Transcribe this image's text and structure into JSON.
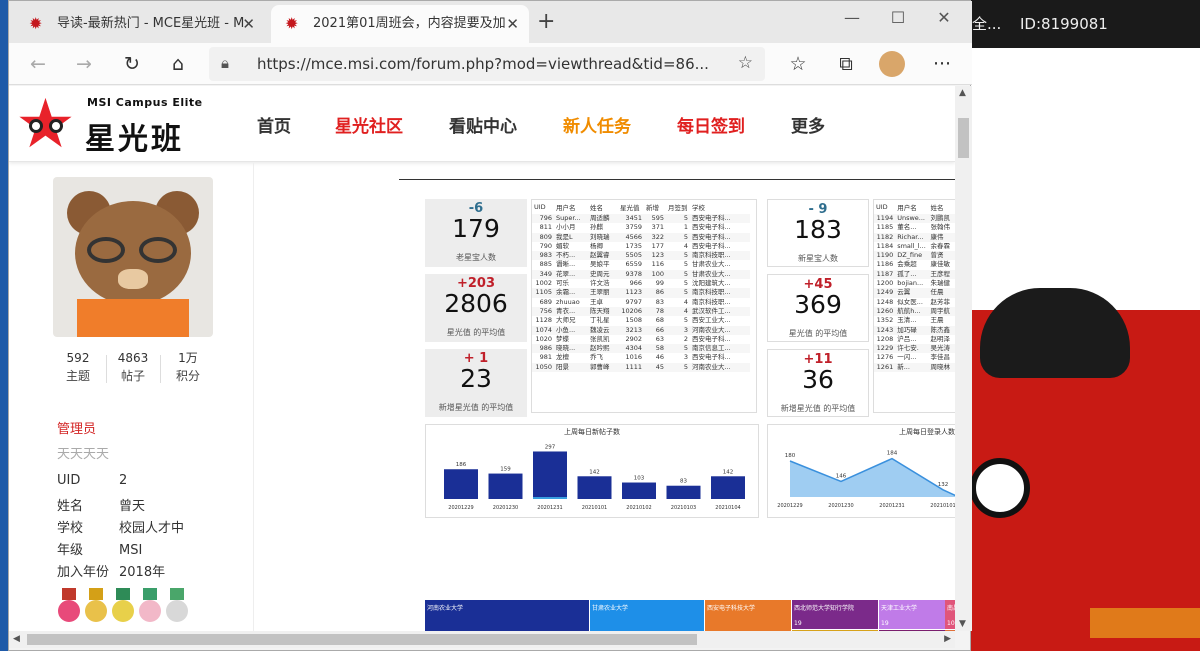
{
  "window": {
    "tabs": [
      {
        "label": "导读-最新热门 - MCE星光班 - M"
      },
      {
        "label": "2021第01周班会，内容提要及加"
      }
    ],
    "new_tab": "+",
    "min": "—",
    "max": "☐",
    "close": "✕"
  },
  "toolbar": {
    "back": "←",
    "forward": "→",
    "refresh": "↻",
    "home": "⌂",
    "url": "https://mce.msi.com/forum.php?mod=viewthread&tid=86...",
    "fav": "☆",
    "favbar": "☆",
    "collections": "⧉",
    "more": "···"
  },
  "right_panel": {
    "text1": "全...",
    "text2": "ID:8199081"
  },
  "site": {
    "logo_en": "MSI Campus Elite",
    "logo_cn": "星光班",
    "nav": [
      {
        "label": "首页",
        "color": "#333333"
      },
      {
        "label": "星光社区",
        "color": "#e02020"
      },
      {
        "label": "看贴中心",
        "color": "#333333"
      },
      {
        "label": "新人任务",
        "color": "#f08c00"
      },
      {
        "label": "每日签到",
        "color": "#e02020"
      },
      {
        "label": "更多",
        "color": "#333333"
      }
    ]
  },
  "profile": {
    "stats": [
      {
        "value": "592",
        "label": "主题"
      },
      {
        "value": "4863",
        "label": "帖子"
      },
      {
        "value": "1万",
        "label": "积分"
      }
    ],
    "role": "管理员",
    "role_sub": "天天天天",
    "info": [
      {
        "k": "UID",
        "v": "2"
      },
      {
        "k": "姓名",
        "v": "曾天"
      },
      {
        "k": "学校",
        "v": "校园人才中"
      },
      {
        "k": "年级",
        "v": "MSI"
      },
      {
        "k": "加入年份",
        "v": "2018年"
      }
    ]
  },
  "kpis_left": [
    {
      "delta": "-6",
      "delta_color": "#2f6e8e",
      "value": "179",
      "label": "老星宝人数"
    },
    {
      "delta": "+203",
      "delta_color": "#c0202a",
      "value": "2806",
      "label": "星光值 的平均值"
    },
    {
      "delta": "+ 1",
      "delta_color": "#c0202a",
      "value": "23",
      "label": "新增星光值 的平均值"
    }
  ],
  "kpis_right": [
    {
      "delta": "- 9",
      "delta_color": "#2f6e8e",
      "value": "183",
      "label": "新星宝人数"
    },
    {
      "delta": "+45",
      "delta_color": "#c0202a",
      "value": "369",
      "label": "星光值 的平均值"
    },
    {
      "delta": "+11",
      "delta_color": "#c0202a",
      "value": "36",
      "label": "新增星光值 的平均值"
    }
  ],
  "table1": {
    "headers": [
      "UID",
      "用户名",
      "姓名",
      "星光值",
      "新增",
      "月签到",
      "学校"
    ],
    "rows": [
      [
        "796",
        "Super...",
        "周适麟",
        "3451",
        "595",
        "5",
        "西安电子科..."
      ],
      [
        "811",
        "小小月",
        "孙麒",
        "3759",
        "371",
        "1",
        "西安电子科..."
      ],
      [
        "809",
        "我是L",
        "刘晓瑞",
        "4566",
        "322",
        "5",
        "西安电子科..."
      ],
      [
        "790",
        "媚软",
        "杨卿",
        "1735",
        "177",
        "4",
        "西安电子科..."
      ],
      [
        "983",
        "不朽...",
        "赵翼睿",
        "5505",
        "123",
        "5",
        "南京科技职..."
      ],
      [
        "885",
        "谮晰...",
        "吴娘平",
        "6559",
        "116",
        "5",
        "甘肃农业大..."
      ],
      [
        "349",
        "花翠...",
        "史周元",
        "9378",
        "100",
        "5",
        "甘肃农业大..."
      ],
      [
        "1002",
        "可乐",
        "许文浩",
        "966",
        "99",
        "5",
        "沈阳建筑大..."
      ],
      [
        "1105",
        "余霜...",
        "王翠丽",
        "1123",
        "86",
        "5",
        "南京科技职..."
      ],
      [
        "689",
        "zhuuao",
        "王卓",
        "9797",
        "83",
        "4",
        "南京科技职..."
      ],
      [
        "756",
        "青衣...",
        "陈天翔",
        "10206",
        "78",
        "4",
        "武汉软件工..."
      ],
      [
        "1128",
        "大师兄",
        "丁礼星",
        "1508",
        "68",
        "5",
        "西安工业大..."
      ],
      [
        "1074",
        "小鱼...",
        "魏凌云",
        "3213",
        "66",
        "3",
        "河南农业大..."
      ],
      [
        "1020",
        "梦蝶",
        "张凯凯",
        "2902",
        "63",
        "2",
        "西安电子科..."
      ],
      [
        "986",
        "晓晓...",
        "赵吟熙",
        "4304",
        "58",
        "5",
        "南京信息工..."
      ],
      [
        "981",
        "龙檀",
        "乔飞",
        "1016",
        "46",
        "3",
        "西安电子科..."
      ],
      [
        "1050",
        "阳景",
        "郭曹峰",
        "1111",
        "45",
        "5",
        "河南农业大..."
      ]
    ]
  },
  "table2": {
    "headers": [
      "UID",
      "用户名",
      "姓名"
    ],
    "rows": [
      [
        "1194",
        "Unswe...",
        "刘鹏凯"
      ],
      [
        "1185",
        "董名...",
        "张翰伟"
      ],
      [
        "1182",
        "Richar...",
        "康伟"
      ],
      [
        "1184",
        "small_l...",
        "余春霖"
      ],
      [
        "1190",
        "DZ_fine",
        "曾贤"
      ],
      [
        "1186",
        "会乘超",
        "康佳敏"
      ],
      [
        "1187",
        "孤了...",
        "王彦程"
      ],
      [
        "1200",
        "bojian...",
        "朱瑞健"
      ],
      [
        "1249",
        "云翼",
        "任晨"
      ],
      [
        "1248",
        "似女医...",
        "赵芳菲"
      ],
      [
        "1260",
        "航航h...",
        "周宇航"
      ],
      [
        "1352",
        "玉清...",
        "王晨"
      ],
      [
        "1243",
        "加巧碌",
        "陈杰鑫"
      ],
      [
        "1208",
        "沪吕...",
        "赵明泽"
      ],
      [
        "1229",
        "许七安.",
        "吴光涛"
      ],
      [
        "1276",
        "一闪...",
        "李佳昌"
      ],
      [
        "1261",
        "新...",
        "周晓林"
      ]
    ]
  },
  "chart_data": [
    {
      "type": "bar",
      "title": "上周每日新帖子数",
      "categories": [
        "20201229",
        "20201230",
        "20201231",
        "20210101",
        "20210102",
        "20210103",
        "20210104"
      ],
      "values": [
        186,
        159,
        297,
        142,
        103,
        83,
        142
      ],
      "colors": {
        "bar": "#1a2f96",
        "highlight": "#3aa0e0"
      }
    },
    {
      "type": "area",
      "title": "上周每日登录人数",
      "categories": [
        "20201229",
        "20201230",
        "20201231",
        "20210101"
      ],
      "values": [
        180,
        146,
        184,
        132
      ],
      "colors": {
        "fill": "#9fcdf2",
        "line": "#3a90dd"
      }
    },
    {
      "type": "table",
      "title": "",
      "nodes": [
        {
          "name": "河南农业大学",
          "value": 73,
          "color": "#1a2f96"
        },
        {
          "name": "甘肃农业大学",
          "value": 51,
          "color": "#1e8fe8"
        },
        {
          "name": "西安电子科技大学",
          "value": 39,
          "color": "#e8792a"
        },
        {
          "name": "西北师范大学知行学院",
          "value": 19,
          "color": "#7b2a8a"
        },
        {
          "name": "北京交通大学海滨学院",
          "value": 19,
          "color": "#d7a21a"
        },
        {
          "name": "天津工业大学",
          "value": 19,
          "color": "#c07be8"
        },
        {
          "name": "沈阳航空航天大学",
          "value": 16,
          "color": "#7a1e6e"
        },
        {
          "name": "南昌...",
          "value": 10,
          "color": "#e0557a"
        },
        {
          "name": "天津...",
          "value": 8,
          "color": "#e0703a"
        }
      ]
    }
  ]
}
